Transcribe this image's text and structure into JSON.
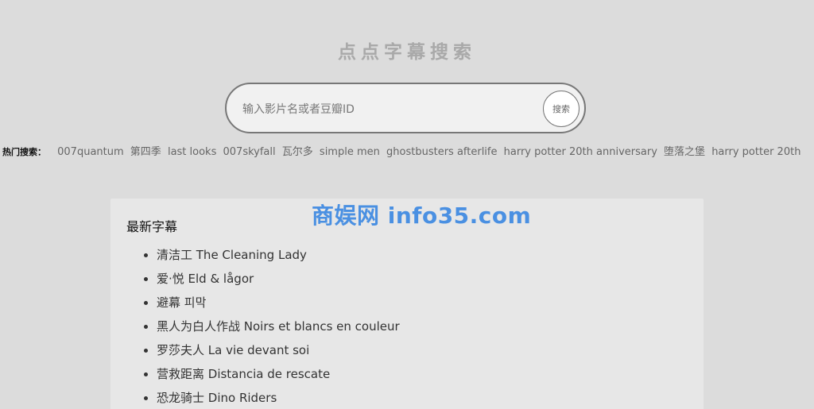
{
  "header": {
    "title": "点点字幕搜索"
  },
  "search": {
    "placeholder": "输入影片名或者豆瓣ID",
    "button_label": "搜索"
  },
  "hot": {
    "label": "热门搜索：",
    "items": [
      "007quantum",
      "第四季",
      "last looks",
      "007skyfall",
      "瓦尔多",
      "simple men",
      "ghostbusters afterlife",
      "harry potter 20th anniversary",
      "堕落之堡",
      "harry potter 20th"
    ]
  },
  "latest": {
    "title": "最新字幕",
    "items": [
      "清洁工 The Cleaning Lady",
      "爱·悦 Eld & lågor",
      "避幕 피막",
      "黑人为白人作战 Noirs et blancs en couleur",
      "罗莎夫人 La vie devant soi",
      "营救距离 Distancia de rescate",
      "恐龙骑士 Dino Riders"
    ]
  },
  "watermark": {
    "text": "商娱网 info35.com"
  },
  "colors": {
    "accent": "#4a90e2",
    "background": "#dcdcdc",
    "card": "#e7e7e7"
  }
}
